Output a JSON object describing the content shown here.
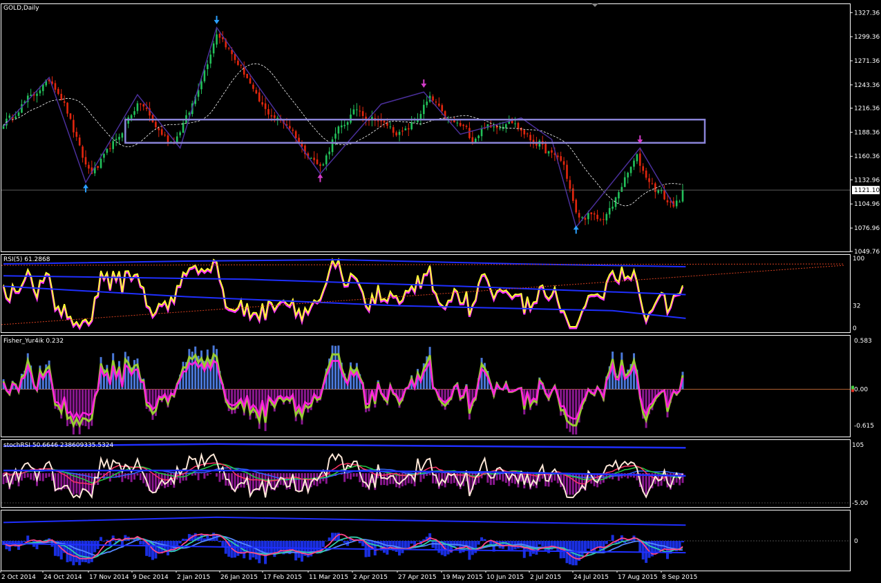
{
  "window": {
    "title": "GOLD,Daily"
  },
  "colors": {
    "background": "#000000",
    "frame": "#ffffff",
    "bull": "#22c05a",
    "bear": "#e2260e",
    "ma_dashed": "#ffffff",
    "zigzag": "#4a2f9a",
    "box": "#8a84d8",
    "arrow_up": "#2aa0ff",
    "arrow_down_pink": "#d23cc8",
    "rsi_main": "#ffff33",
    "rsi_shadow": "#ff33ff",
    "blue_band": "#1f2fff",
    "red_dots": "#d84020",
    "fisher_line": "#99cc33",
    "fisher_pink": "#ff22dd",
    "hist_pos": "#4a78d8",
    "hist_neg": "#8a1890",
    "stoch_white": "#ffe8d8"
  },
  "main_panel": {
    "y_ticks": [
      "1327.36",
      "1299.36",
      "1271.36",
      "1243.36",
      "1216.36",
      "1188.36",
      "1160.36",
      "1132.96",
      "1104.96",
      "1076.96",
      "1049.76"
    ],
    "current_price": "1121.10"
  },
  "rsi_panel": {
    "title": "RSI(5) 61.2868",
    "levels": [
      "100",
      "32",
      "0"
    ]
  },
  "fisher_panel": {
    "title": "Fisher_Yur4ik 0.232",
    "levels": [
      "0.583",
      "0.00",
      "-0.615"
    ]
  },
  "stoch_panel": {
    "title": "stochRSI 50.6646 238609335.5324",
    "levels": [
      "105",
      "-5.00"
    ]
  },
  "bottom_panel": {
    "title": "",
    "levels": [
      "0"
    ]
  },
  "x_axis": {
    "labels": [
      "2 Oct 2014",
      "24 Oct 2014",
      "17 Nov 2014",
      "9 Dec 2014",
      "2 Jan 2015",
      "26 Jan 2015",
      "17 Feb 2015",
      "11 Mar 2015",
      "2 Apr 2015",
      "27 Apr 2015",
      "19 May 2015",
      "10 Jun 2015",
      "2 Jul 2015",
      "24 Jul 2015",
      "17 Aug 2015",
      "8 Sep 2015"
    ]
  },
  "chart_data": {
    "type": "candlestick",
    "title": "GOLD,Daily",
    "symbol": "GOLD",
    "timeframe": "Daily",
    "ylim": [
      1049.76,
      1338
    ],
    "close_path": [
      [
        0,
        1199
      ],
      [
        4,
        1210
      ],
      [
        8,
        1228
      ],
      [
        10,
        1232
      ],
      [
        13,
        1242
      ],
      [
        15,
        1250
      ],
      [
        17,
        1241
      ],
      [
        19,
        1228
      ],
      [
        21,
        1212
      ],
      [
        23,
        1190
      ],
      [
        25,
        1170
      ],
      [
        27,
        1150
      ],
      [
        29,
        1142
      ],
      [
        31,
        1148
      ],
      [
        33,
        1160
      ],
      [
        35,
        1172
      ],
      [
        37,
        1178
      ],
      [
        39,
        1190
      ],
      [
        41,
        1205
      ],
      [
        43,
        1215
      ],
      [
        45,
        1222
      ],
      [
        47,
        1214
      ],
      [
        49,
        1200
      ],
      [
        51,
        1190
      ],
      [
        53,
        1183
      ],
      [
        55,
        1176
      ],
      [
        57,
        1183
      ],
      [
        59,
        1198
      ],
      [
        61,
        1212
      ],
      [
        63,
        1230
      ],
      [
        65,
        1250
      ],
      [
        67,
        1270
      ],
      [
        69,
        1292
      ],
      [
        70,
        1304
      ],
      [
        72,
        1296
      ],
      [
        74,
        1284
      ],
      [
        76,
        1273
      ],
      [
        78,
        1263
      ],
      [
        80,
        1252
      ],
      [
        82,
        1236
      ],
      [
        84,
        1224
      ],
      [
        86,
        1214
      ],
      [
        88,
        1208
      ],
      [
        90,
        1203
      ],
      [
        92,
        1200
      ],
      [
        94,
        1194
      ],
      [
        96,
        1184
      ],
      [
        98,
        1170
      ],
      [
        100,
        1162
      ],
      [
        102,
        1155
      ],
      [
        104,
        1148
      ],
      [
        106,
        1160
      ],
      [
        108,
        1178
      ],
      [
        110,
        1192
      ],
      [
        112,
        1198
      ],
      [
        114,
        1207
      ],
      [
        116,
        1216
      ],
      [
        118,
        1210
      ],
      [
        120,
        1203
      ],
      [
        122,
        1205
      ],
      [
        124,
        1199
      ],
      [
        126,
        1197
      ],
      [
        128,
        1190
      ],
      [
        130,
        1186
      ],
      [
        132,
        1190
      ],
      [
        134,
        1197
      ],
      [
        136,
        1204
      ],
      [
        138,
        1218
      ],
      [
        140,
        1228
      ],
      [
        142,
        1222
      ],
      [
        144,
        1210
      ],
      [
        146,
        1202
      ],
      [
        148,
        1200
      ],
      [
        150,
        1196
      ],
      [
        152,
        1192
      ],
      [
        154,
        1178
      ],
      [
        156,
        1186
      ],
      [
        158,
        1196
      ],
      [
        160,
        1193
      ],
      [
        162,
        1196
      ],
      [
        164,
        1196
      ],
      [
        166,
        1204
      ],
      [
        168,
        1197
      ],
      [
        170,
        1190
      ],
      [
        172,
        1184
      ],
      [
        174,
        1176
      ],
      [
        176,
        1175
      ],
      [
        178,
        1167
      ],
      [
        180,
        1162
      ],
      [
        182,
        1160
      ],
      [
        184,
        1150
      ],
      [
        186,
        1122
      ],
      [
        188,
        1093
      ],
      [
        190,
        1088
      ],
      [
        192,
        1092
      ],
      [
        194,
        1090
      ],
      [
        196,
        1086
      ],
      [
        198,
        1093
      ],
      [
        200,
        1102
      ],
      [
        202,
        1120
      ],
      [
        204,
        1133
      ],
      [
        206,
        1148
      ],
      [
        208,
        1160
      ],
      [
        210,
        1143
      ],
      [
        212,
        1132
      ],
      [
        214,
        1122
      ],
      [
        216,
        1118
      ],
      [
        218,
        1107
      ],
      [
        220,
        1105
      ],
      [
        222,
        1106
      ],
      [
        223,
        1121.1
      ]
    ],
    "panels": [
      {
        "name": "RSI(5)",
        "value": 61.2868,
        "ylim": [
          0,
          100
        ],
        "levels": [
          100,
          32,
          0
        ]
      },
      {
        "name": "Fisher_Yur4ik",
        "value": 0.232,
        "ylim": [
          -0.615,
          0.583
        ]
      },
      {
        "name": "stochRSI",
        "values": [
          50.6646,
          238609335.5324
        ],
        "ylim": [
          -5,
          105
        ]
      }
    ]
  }
}
